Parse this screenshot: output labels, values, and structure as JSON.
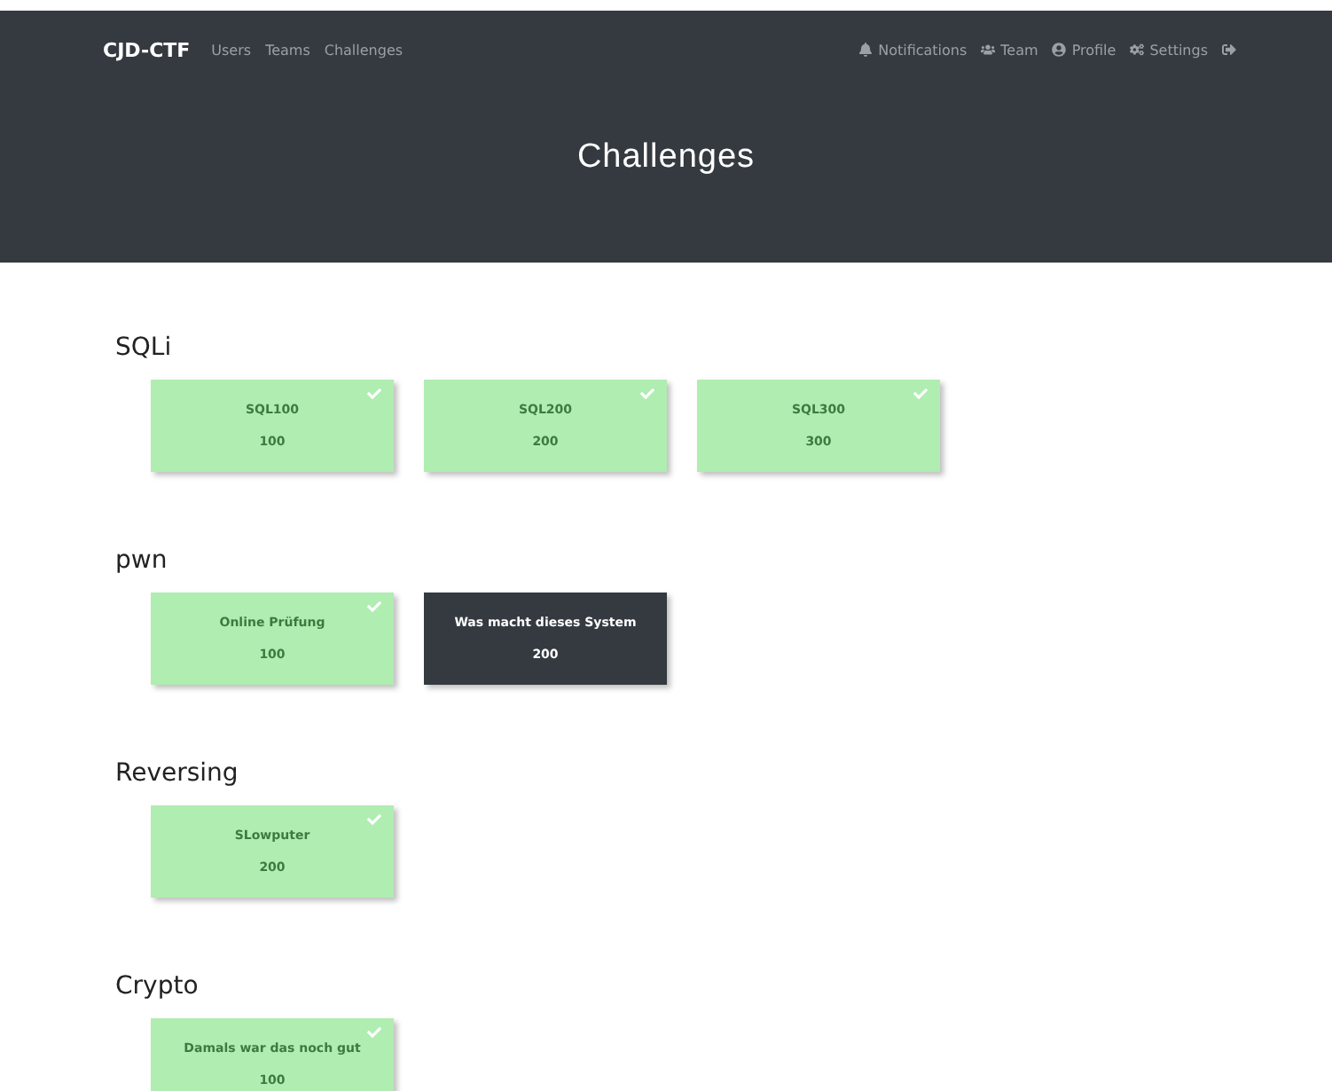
{
  "navbar": {
    "brand": "CJD-CTF",
    "links": [
      "Users",
      "Teams",
      "Challenges"
    ],
    "right_links": [
      {
        "kind": "notifications",
        "label": "Notifications"
      },
      {
        "kind": "team",
        "label": "Team"
      },
      {
        "kind": "profile",
        "label": "Profile"
      },
      {
        "kind": "settings",
        "label": "Settings"
      },
      {
        "kind": "logout"
      }
    ]
  },
  "header": {
    "title": "Challenges"
  },
  "categories": [
    {
      "name": "SQLi",
      "challenges": [
        {
          "name": "SQL100",
          "points": "100",
          "solved": true
        },
        {
          "name": "SQL200",
          "points": "200",
          "solved": true
        },
        {
          "name": "SQL300",
          "points": "300",
          "solved": true
        }
      ]
    },
    {
      "name": "pwn",
      "challenges": [
        {
          "name": "Online Prüfung",
          "points": "100",
          "solved": true
        },
        {
          "name": "Was macht dieses System",
          "points": "200",
          "solved": false
        }
      ]
    },
    {
      "name": "Reversing",
      "challenges": [
        {
          "name": "SLowputer",
          "points": "200",
          "solved": true
        }
      ]
    },
    {
      "name": "Crypto",
      "challenges": [
        {
          "name": "Damals war das noch gut",
          "points": "100",
          "solved": true
        }
      ]
    }
  ]
}
